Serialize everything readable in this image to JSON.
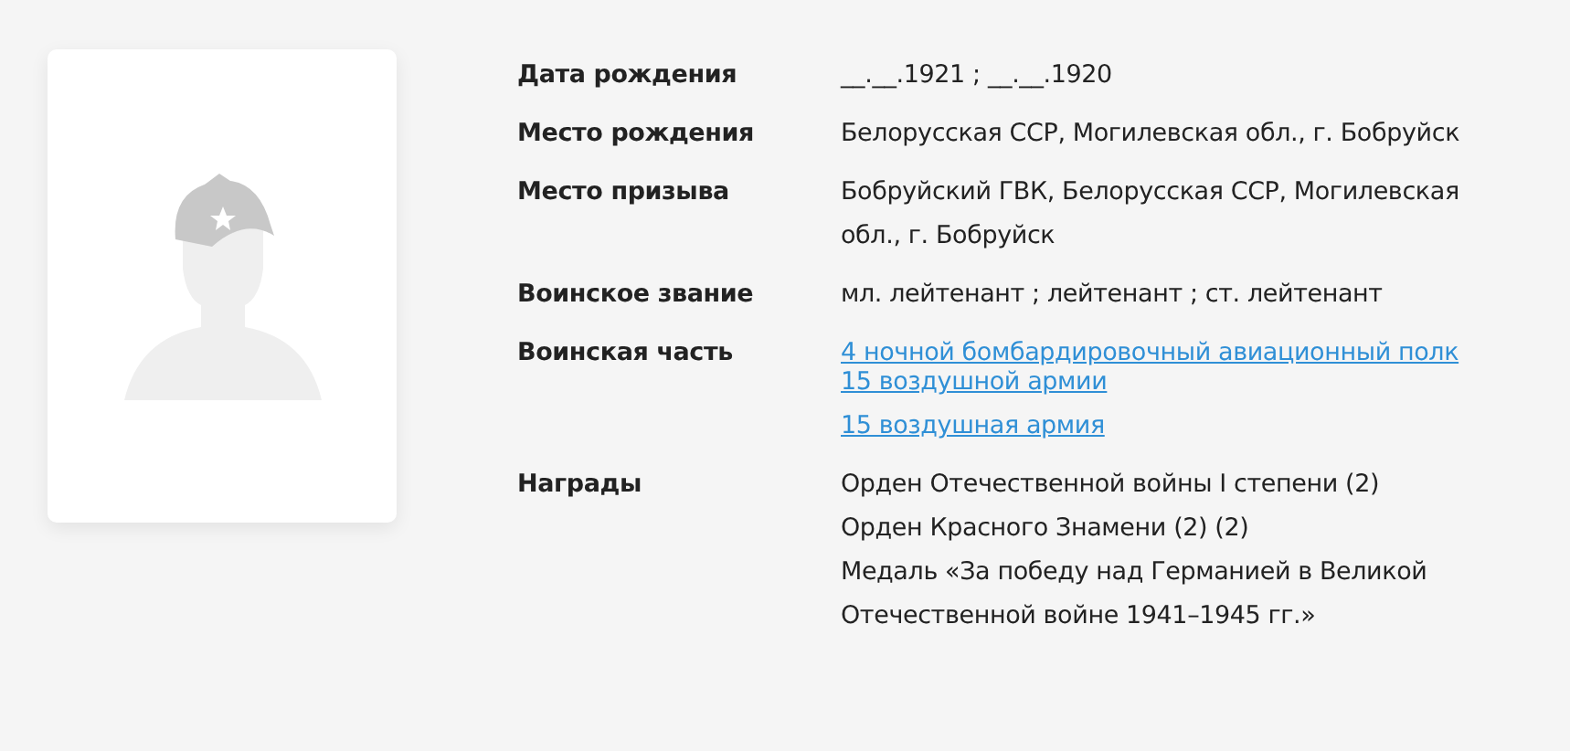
{
  "profile": {
    "photo": {
      "kind": "placeholder"
    }
  },
  "fields": [
    {
      "label": "Дата рождения",
      "values": [
        {
          "kind": "text",
          "text": "__.__.1921 ; __.__.1920"
        }
      ]
    },
    {
      "label": "Место рождения",
      "values": [
        {
          "kind": "text",
          "text": "Белорусская ССР, Могилевская обл., г. Бобруйск"
        }
      ]
    },
    {
      "label": "Место призыва",
      "values": [
        {
          "kind": "text",
          "text": "Бобруйский ГВК, Белорусская ССР, Могилевская обл., г. Бобруйск"
        }
      ]
    },
    {
      "label": "Воинское звание",
      "values": [
        {
          "kind": "text",
          "text": "мл. лейтенант ; лейтенант ; ст. лейтенант"
        }
      ]
    },
    {
      "label": "Воинская часть",
      "values": [
        {
          "kind": "link",
          "text": "4 ночной бомбардировочный авиационный полк 15 воздушной армии"
        },
        {
          "kind": "link",
          "text": "15 воздушная армия"
        }
      ]
    },
    {
      "label": "Награды",
      "values": [
        {
          "kind": "text",
          "text": "Орден Отечественной войны I степени (2)"
        },
        {
          "kind": "text",
          "text": "Орден Красного Знамени (2) (2)"
        },
        {
          "kind": "text",
          "text": "Медаль «За победу над Германией в Великой Отечественной войне 1941–1945 гг.»"
        }
      ]
    }
  ]
}
